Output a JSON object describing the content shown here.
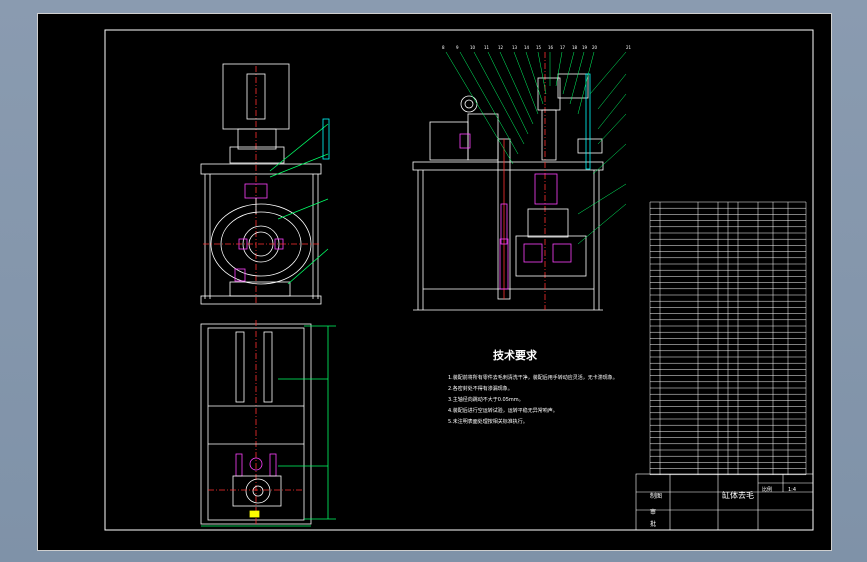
{
  "drawing": {
    "tech_requirements_title": "技术要求",
    "tech_requirements": [
      "1.装配前将所有零件去毛刺清洗干净，装配后用手转动应灵活，无卡滞现象。",
      "2.各密封处不得有渗漏现象。",
      "3.主轴径向跳动不大于0.05mm。",
      "4.装配后进行空运转试验，运转平稳无异常响声。",
      "5.未注明表面处理按相关标准执行。"
    ],
    "title_block": {
      "drawing_name": "缸体去毛",
      "scale_label": "比例",
      "scale_value": "1:4",
      "designed_label": "制图",
      "checked_label": "审",
      "approved_label": "批"
    },
    "colors": {
      "background": "#000000",
      "line": "#ffffff",
      "center_line": "#ff3030",
      "dimension": "#00ff66",
      "part_label": "#00ffff",
      "magenta_parts": "#ff40ff",
      "highlight": "#ffff00",
      "leader": "#00ff66"
    }
  }
}
